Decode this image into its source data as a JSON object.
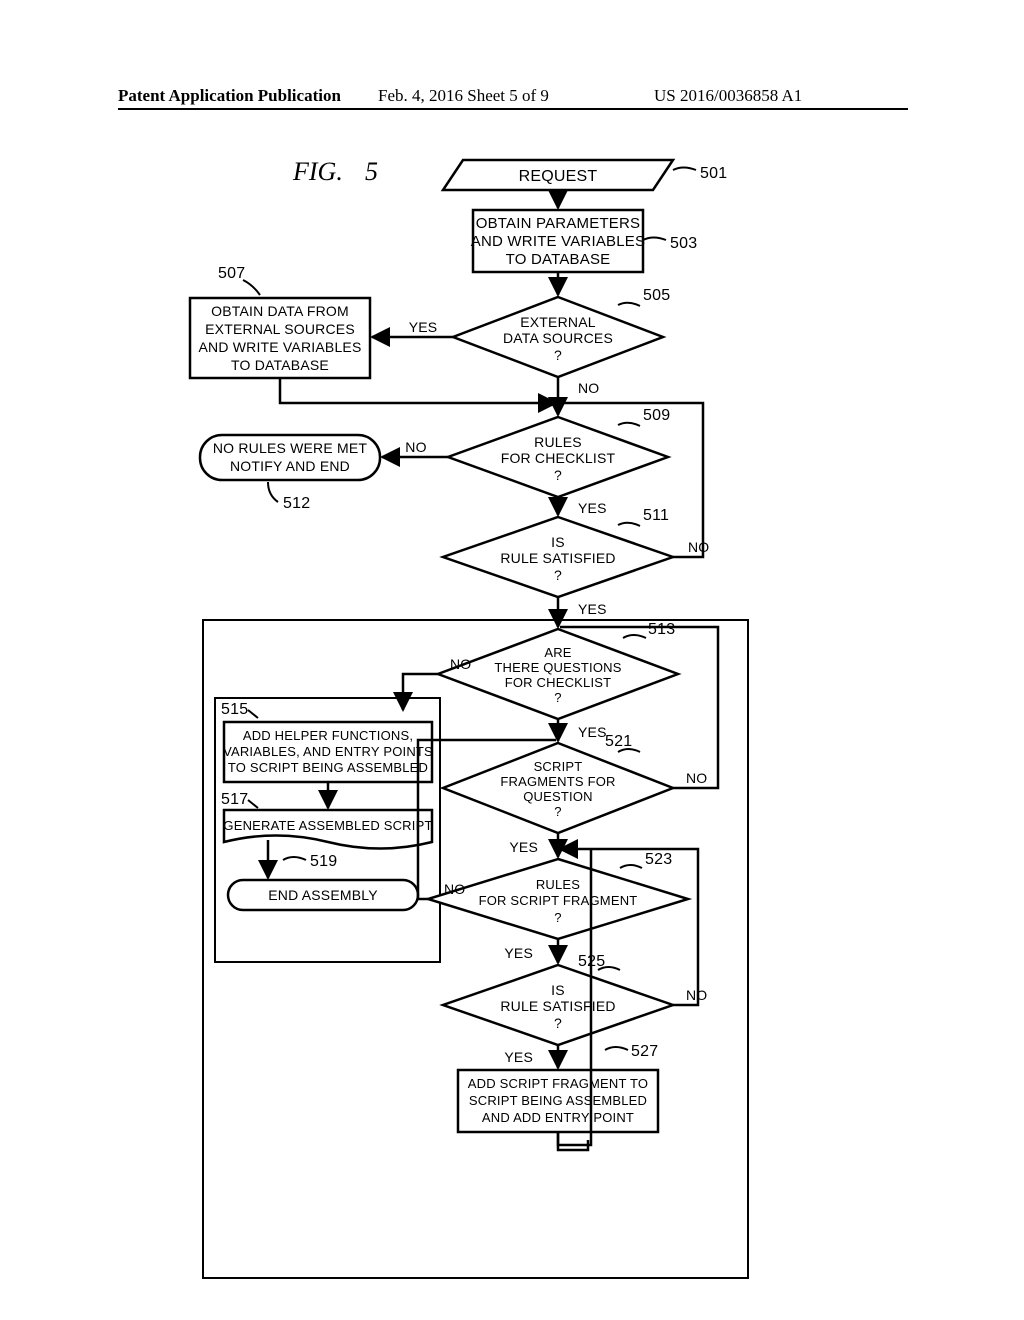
{
  "header": {
    "left": "Patent Application Publication",
    "center": "Feb. 4, 2016   Sheet 5 of 9",
    "right": "US 2016/0036858 A1"
  },
  "figure": {
    "label": "FIG.",
    "number": "5"
  },
  "refs": {
    "n501": "501",
    "n503": "503",
    "n505": "505",
    "n507": "507",
    "n509": "509",
    "n511": "511",
    "n512": "512",
    "n513": "513",
    "n515": "515",
    "n517": "517",
    "n519": "519",
    "n521": "521",
    "n523": "523",
    "n525": "525",
    "n527": "527"
  },
  "connectors": {
    "yes": "YES",
    "no": "NO"
  },
  "nodes": {
    "request": "REQUEST",
    "obtain_params_l1": "OBTAIN PARAMETERS",
    "obtain_params_l2": "AND WRITE VARIABLES",
    "obtain_params_l3": "TO DATABASE",
    "obtain_ext_l1": "OBTAIN DATA FROM",
    "obtain_ext_l2": "EXTERNAL SOURCES",
    "obtain_ext_l3": "AND WRITE VARIABLES",
    "obtain_ext_l4": "TO DATABASE",
    "ext_src_l1": "EXTERNAL",
    "ext_src_l2": "DATA SOURCES",
    "ext_src_l3": "?",
    "no_rules_l1": "NO RULES WERE MET",
    "no_rules_l2": "NOTIFY AND END",
    "rules_chk_l1": "RULES",
    "rules_chk_l2": "FOR CHECKLIST",
    "rules_chk_l3": "?",
    "is_rule_sat_l1": "IS",
    "is_rule_sat_l2": "RULE SATISFIED",
    "is_rule_sat_l3": "?",
    "are_q_l1": "ARE",
    "are_q_l2": "THERE QUESTIONS",
    "are_q_l3": "FOR CHECKLIST",
    "are_q_l4": "?",
    "helper_l1": "ADD HELPER FUNCTIONS,",
    "helper_l2": "VARIABLES, AND ENTRY POINTS",
    "helper_l3": "TO SCRIPT BEING ASSEMBLED",
    "gen_script": "GENERATE ASSEMBLED SCRIPT",
    "end_asm": "END ASSEMBLY",
    "frag_q_l1": "SCRIPT",
    "frag_q_l2": "FRAGMENTS FOR",
    "frag_q_l3": "QUESTION",
    "frag_q_l4": "?",
    "rules_frag_l1": "RULES",
    "rules_frag_l2": "FOR SCRIPT FRAGMENT",
    "rules_frag_l3": "?",
    "is_rule_sat2_l1": "IS",
    "is_rule_sat2_l2": "RULE SATISFIED",
    "is_rule_sat2_l3": "?",
    "add_frag_l1": "ADD SCRIPT FRAGMENT TO",
    "add_frag_l2": "SCRIPT BEING ASSEMBLED",
    "add_frag_l3": "AND ADD ENTRY POINT"
  }
}
